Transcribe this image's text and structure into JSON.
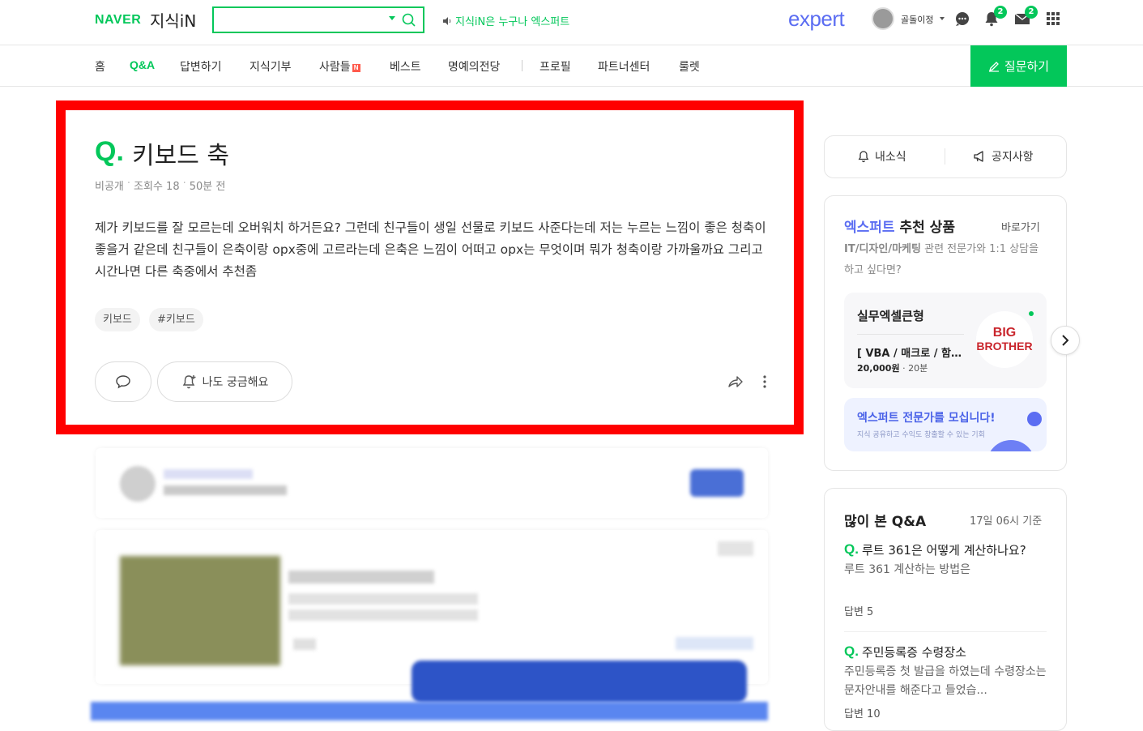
{
  "header": {
    "logo_naver": "NAVER",
    "logo_kin": "지식iN",
    "search_placeholder": "",
    "notice_text": "지식iN은 누구나 엑스퍼트",
    "expert_logo": "expert",
    "username": "골돌이정",
    "notification_count": "2",
    "mail_count": "2"
  },
  "nav": {
    "items": [
      "홈",
      "Q&A",
      "답변하기",
      "지식기부",
      "사람들",
      "베스트",
      "명예의전당",
      "프로필",
      "파트너센터",
      "룰렛"
    ],
    "new_badge": "N",
    "ask_label": "질문하기"
  },
  "question": {
    "q_mark": "Q.",
    "title": "키보드 축",
    "visibility": "비공개",
    "views": "조회수 18",
    "time": "50분 전",
    "body": "제가 키보드를 잘 모르는데 오버워치 하거든요? 그런데 친구들이 생일 선물로 키보드 사준다는데 저는 누르는 느낌이 좋은 청축이 좋을거 같은데 친구들이 은축이랑 opx중에 고르라는데 은축은 느낌이 어떠고 opx는 무엇이며 뭐가 청축이랑 가까울까요 그리고 시간나면 다른 축중에서 추천좀",
    "tags": [
      "키보드",
      "#키보드"
    ],
    "curious_label": "나도 궁금해요"
  },
  "sidebar": {
    "tab_inbox": "내소식",
    "tab_notice": "공지사항",
    "expert_title_accent": "엑스퍼트",
    "expert_title_rest": "추천 상품",
    "expert_goto": "바로가기",
    "expert_desc_bold": "IT/디자인/마케팅",
    "expert_desc_rest": "관련 전문가와 1:1 상담을 하고 싶다면?",
    "product": {
      "name": "실무엑셀큰형",
      "subtitle": "[ VBA / 매크로 / 함수 ]",
      "price": "20,000원",
      "duration": "20분",
      "logo_line1": "BIG",
      "logo_line2": "BROTHER"
    },
    "recruit_title": "엑스퍼트 전문가를 모십니다!",
    "recruit_sub": "지식 공유하고 수익도 창출할 수 있는 기회",
    "popular_title": "많이 본 Q&A",
    "popular_base": "17일 06시 기준",
    "popular": [
      {
        "q": "Q.",
        "title": "루트 361은 어떻게 계산하나요?",
        "snippet": "루트 361 계산하는 방법은",
        "answers": "답변 5"
      },
      {
        "q": "Q.",
        "title": "주민등록증 수령장소",
        "snippet": "주민등록증 첫 발급을 하였는데 수령장소는 문자안내를 해준다고 들었습...",
        "answers": "답변 10"
      }
    ]
  }
}
